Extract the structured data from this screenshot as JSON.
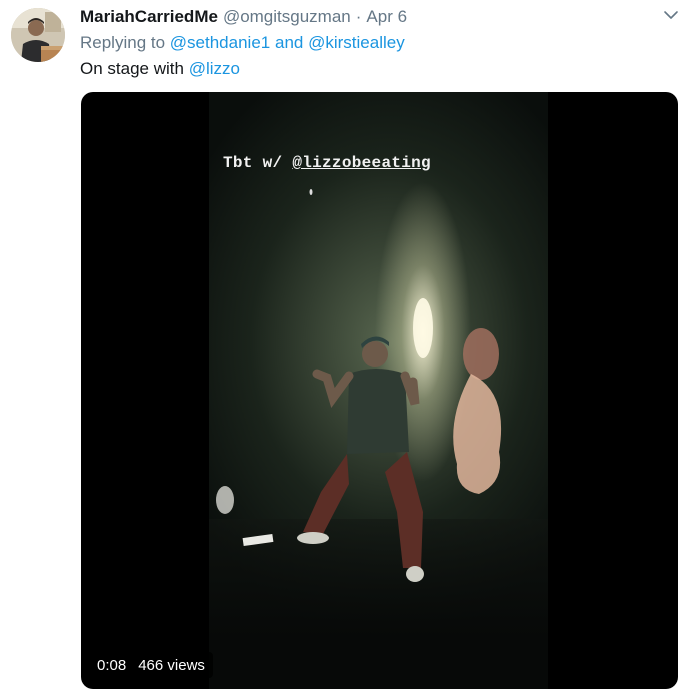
{
  "tweet": {
    "display_name": "MariahCarriedMe",
    "handle": "@omgitsguzman",
    "separator": "·",
    "date": "Apr 6",
    "reply_prefix": "Replying to",
    "reply_user_1": "@sethdanie1",
    "reply_and": "and",
    "reply_user_2": "@kirstiealley",
    "text_prefix": "On stage with",
    "text_mention": "@lizzo"
  },
  "media": {
    "overlay_prefix": "Tbt w/",
    "overlay_mention": "@lizzobeeating",
    "elapsed": "0:08",
    "views": "466 views"
  },
  "icons": {
    "avatar": "avatar-photo",
    "menu": "chevron-down-icon"
  },
  "colors": {
    "link": "#1b95e0",
    "secondary_text": "#657786",
    "primary_text": "#14171a",
    "media_background": "#000000"
  }
}
